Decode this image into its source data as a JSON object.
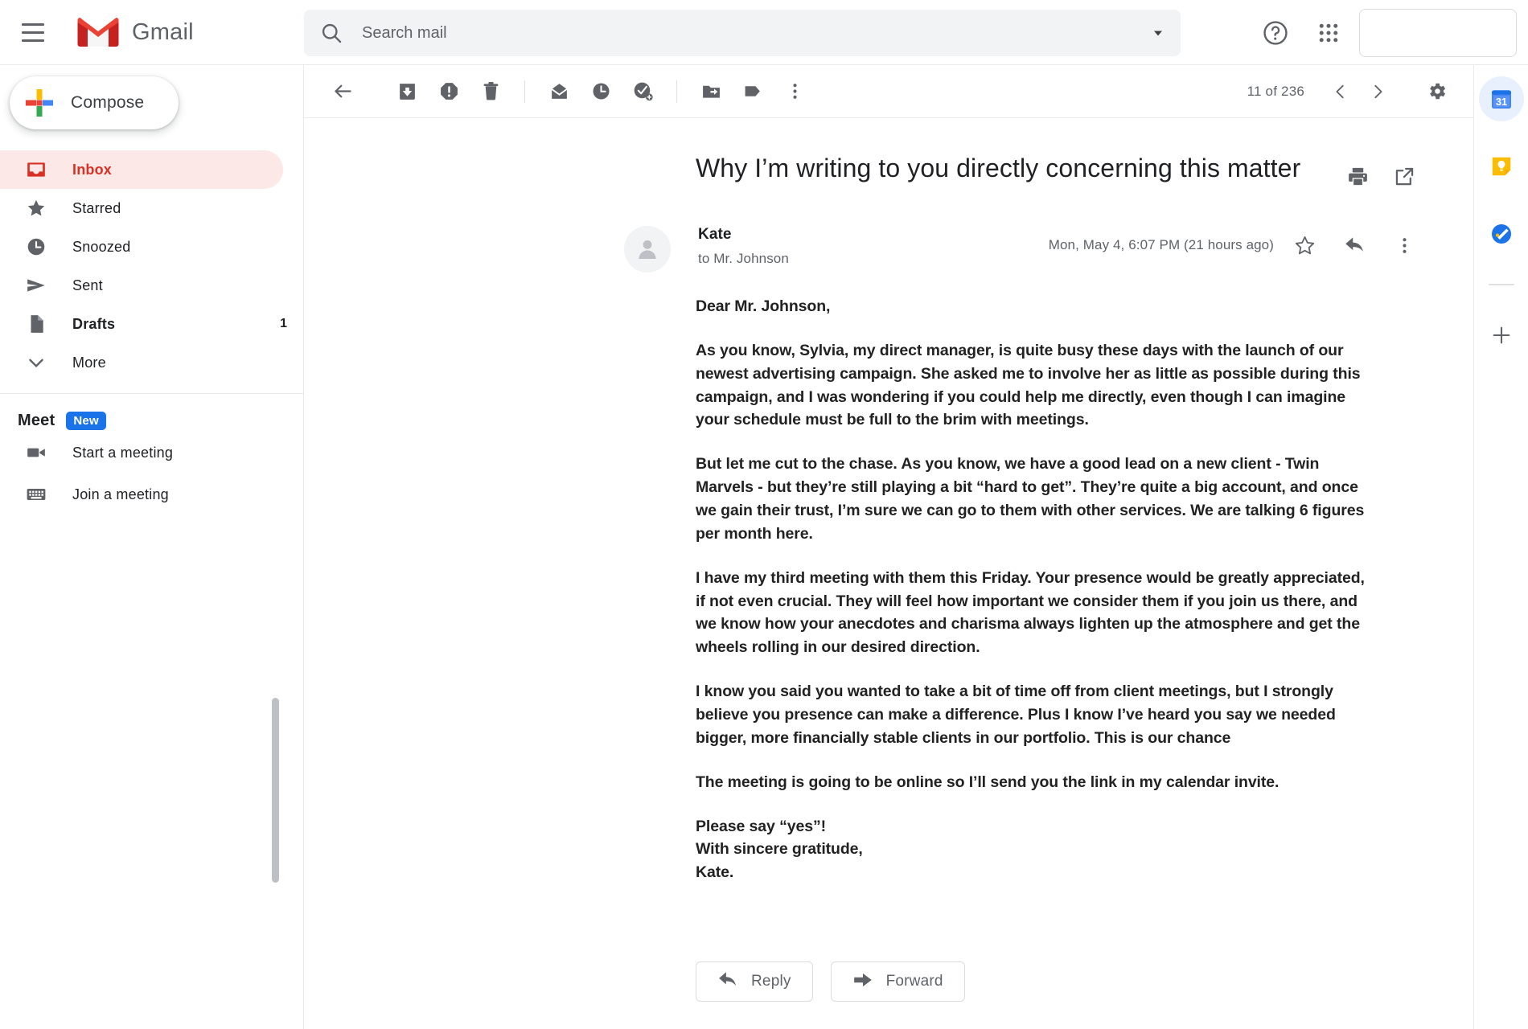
{
  "app": {
    "brand_name": "Gmail",
    "colors": {
      "gmail_red": "#d93025",
      "accent_blue": "#1a73e8",
      "selected_bg": "#fce8e6",
      "text_primary": "#202124",
      "text_secondary": "#5f6368",
      "keep_yellow": "#fbbc04",
      "calendar_blue": "#4285f4"
    }
  },
  "topbar": {
    "menu_icon": "hamburger-menu-icon",
    "logo_icon": "gmail-logo-icon",
    "search": {
      "icon": "search-icon",
      "placeholder": "Search mail",
      "value": "",
      "options_icon": "chevron-down-icon"
    },
    "help_icon": "help-circle-icon",
    "apps_icon": "apps-grid-icon",
    "account_box": "account-avatar-placeholder"
  },
  "sidebar": {
    "compose": {
      "label": "Compose",
      "icon": "plus-multicolor-icon"
    },
    "items": [
      {
        "label": "Inbox",
        "icon": "inbox-icon",
        "count": "",
        "active": true,
        "bold": true
      },
      {
        "label": "Starred",
        "icon": "star-icon",
        "count": "",
        "active": false,
        "bold": false
      },
      {
        "label": "Snoozed",
        "icon": "clock-icon",
        "count": "",
        "active": false,
        "bold": false
      },
      {
        "label": "Sent",
        "icon": "send-icon",
        "count": "",
        "active": false,
        "bold": false
      },
      {
        "label": "Drafts",
        "icon": "draft-icon",
        "count": "1",
        "active": false,
        "bold": true
      },
      {
        "label": "More",
        "icon": "chevron-down-icon",
        "count": "",
        "active": false,
        "bold": false
      }
    ],
    "meet": {
      "title": "Meet",
      "badge": "New",
      "items": [
        {
          "label": "Start a meeting",
          "icon": "video-camera-icon"
        },
        {
          "label": "Join a meeting",
          "icon": "keyboard-icon"
        }
      ]
    }
  },
  "toolbar": {
    "back_icon": "back-arrow-icon",
    "archive_icon": "archive-icon",
    "spam_icon": "report-spam-icon",
    "delete_icon": "trash-icon",
    "unread_icon": "mark-unread-icon",
    "snooze_icon": "snooze-clock-icon",
    "task_icon": "add-to-tasks-icon",
    "move_icon": "move-to-folder-icon",
    "label_icon": "label-tag-icon",
    "more_icon": "more-vertical-icon",
    "pagination": "11 of 236",
    "prev_icon": "chevron-left-icon",
    "next_icon": "chevron-right-icon",
    "settings_icon": "gear-icon"
  },
  "email": {
    "subject": "Why I’m writing to you directly concerning this matter",
    "print_icon": "printer-icon",
    "popout_icon": "open-in-new-icon",
    "avatar_icon": "person-avatar-icon",
    "sender": "Kate",
    "recipient": "to Mr. Johnson",
    "date": "Mon, May 4, 6:07 PM (21 hours ago)",
    "star_icon": "star-outline-icon",
    "reply_arrow_icon": "reply-arrow-icon",
    "more_icon": "more-vertical-icon",
    "paragraphs": [
      "Dear Mr. Johnson,",
      "As you know, Sylvia, my direct manager, is quite busy these days with the launch of our newest advertising campaign. She asked me to involve her as little as possible during this campaign, and I was wondering if you could help me directly, even though I can imagine your schedule must be full to the brim with meetings.",
      "But let me cut to the chase. As you know, we have a good lead on a new client - Twin Marvels - but they’re still playing a bit “hard to get”. They’re quite a big account, and once we gain their trust, I’m sure we can go to them with other services. We are talking 6 figures per month here.",
      "I have my third meeting with them this Friday. Your presence would be greatly appreciated, if not even crucial. They will feel how important we consider them if you join us there, and we know how your anecdotes and charisma always lighten up the atmosphere and get the wheels rolling in our desired direction.",
      "I know you said you wanted to take a bit of time off from client meetings, but I strongly believe you presence can make a difference. Plus I know I’ve heard you say we needed bigger, more financially stable clients in our portfolio. This is our chance",
      "The meeting is going to be online so I’ll send you the link in my calendar invite."
    ],
    "signature": [
      "Please say “yes”!",
      "With sincere gratitude,",
      "Kate."
    ],
    "actions": {
      "reply": {
        "label": "Reply",
        "icon": "reply-arrow-icon"
      },
      "forward": {
        "label": "Forward",
        "icon": "forward-arrow-icon"
      }
    }
  },
  "rightrail": {
    "items": [
      {
        "icon": "google-calendar-icon",
        "day": "31",
        "selected": true
      },
      {
        "icon": "google-keep-icon",
        "day": "",
        "selected": false
      },
      {
        "icon": "google-tasks-icon",
        "day": "",
        "selected": false
      }
    ],
    "add_icon": "plus-icon"
  }
}
